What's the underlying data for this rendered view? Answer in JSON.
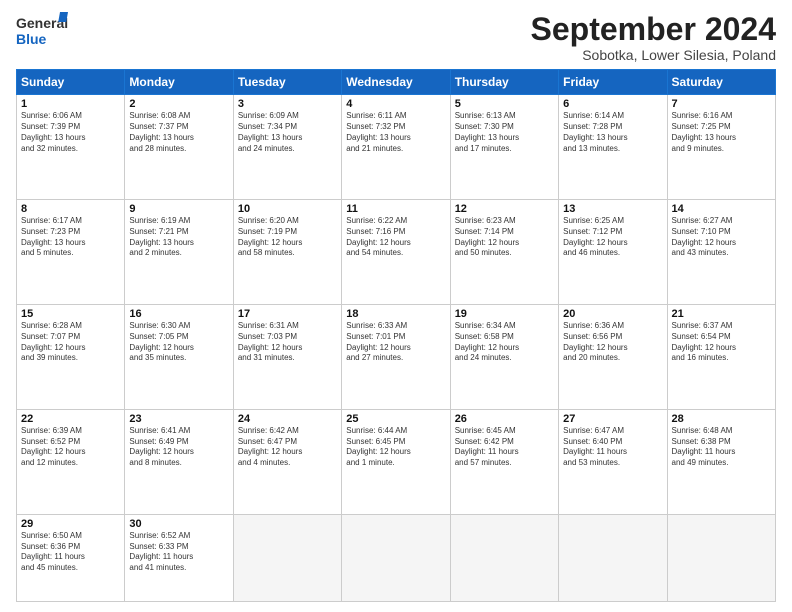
{
  "header": {
    "logo_line1": "General",
    "logo_line2": "Blue",
    "month": "September 2024",
    "location": "Sobotka, Lower Silesia, Poland"
  },
  "weekdays": [
    "Sunday",
    "Monday",
    "Tuesday",
    "Wednesday",
    "Thursday",
    "Friday",
    "Saturday"
  ],
  "weeks": [
    [
      {
        "day": "1",
        "text": "Sunrise: 6:06 AM\nSunset: 7:39 PM\nDaylight: 13 hours\nand 32 minutes."
      },
      {
        "day": "2",
        "text": "Sunrise: 6:08 AM\nSunset: 7:37 PM\nDaylight: 13 hours\nand 28 minutes."
      },
      {
        "day": "3",
        "text": "Sunrise: 6:09 AM\nSunset: 7:34 PM\nDaylight: 13 hours\nand 24 minutes."
      },
      {
        "day": "4",
        "text": "Sunrise: 6:11 AM\nSunset: 7:32 PM\nDaylight: 13 hours\nand 21 minutes."
      },
      {
        "day": "5",
        "text": "Sunrise: 6:13 AM\nSunset: 7:30 PM\nDaylight: 13 hours\nand 17 minutes."
      },
      {
        "day": "6",
        "text": "Sunrise: 6:14 AM\nSunset: 7:28 PM\nDaylight: 13 hours\nand 13 minutes."
      },
      {
        "day": "7",
        "text": "Sunrise: 6:16 AM\nSunset: 7:25 PM\nDaylight: 13 hours\nand 9 minutes."
      }
    ],
    [
      {
        "day": "8",
        "text": "Sunrise: 6:17 AM\nSunset: 7:23 PM\nDaylight: 13 hours\nand 5 minutes."
      },
      {
        "day": "9",
        "text": "Sunrise: 6:19 AM\nSunset: 7:21 PM\nDaylight: 13 hours\nand 2 minutes."
      },
      {
        "day": "10",
        "text": "Sunrise: 6:20 AM\nSunset: 7:19 PM\nDaylight: 12 hours\nand 58 minutes."
      },
      {
        "day": "11",
        "text": "Sunrise: 6:22 AM\nSunset: 7:16 PM\nDaylight: 12 hours\nand 54 minutes."
      },
      {
        "day": "12",
        "text": "Sunrise: 6:23 AM\nSunset: 7:14 PM\nDaylight: 12 hours\nand 50 minutes."
      },
      {
        "day": "13",
        "text": "Sunrise: 6:25 AM\nSunset: 7:12 PM\nDaylight: 12 hours\nand 46 minutes."
      },
      {
        "day": "14",
        "text": "Sunrise: 6:27 AM\nSunset: 7:10 PM\nDaylight: 12 hours\nand 43 minutes."
      }
    ],
    [
      {
        "day": "15",
        "text": "Sunrise: 6:28 AM\nSunset: 7:07 PM\nDaylight: 12 hours\nand 39 minutes."
      },
      {
        "day": "16",
        "text": "Sunrise: 6:30 AM\nSunset: 7:05 PM\nDaylight: 12 hours\nand 35 minutes."
      },
      {
        "day": "17",
        "text": "Sunrise: 6:31 AM\nSunset: 7:03 PM\nDaylight: 12 hours\nand 31 minutes."
      },
      {
        "day": "18",
        "text": "Sunrise: 6:33 AM\nSunset: 7:01 PM\nDaylight: 12 hours\nand 27 minutes."
      },
      {
        "day": "19",
        "text": "Sunrise: 6:34 AM\nSunset: 6:58 PM\nDaylight: 12 hours\nand 24 minutes."
      },
      {
        "day": "20",
        "text": "Sunrise: 6:36 AM\nSunset: 6:56 PM\nDaylight: 12 hours\nand 20 minutes."
      },
      {
        "day": "21",
        "text": "Sunrise: 6:37 AM\nSunset: 6:54 PM\nDaylight: 12 hours\nand 16 minutes."
      }
    ],
    [
      {
        "day": "22",
        "text": "Sunrise: 6:39 AM\nSunset: 6:52 PM\nDaylight: 12 hours\nand 12 minutes."
      },
      {
        "day": "23",
        "text": "Sunrise: 6:41 AM\nSunset: 6:49 PM\nDaylight: 12 hours\nand 8 minutes."
      },
      {
        "day": "24",
        "text": "Sunrise: 6:42 AM\nSunset: 6:47 PM\nDaylight: 12 hours\nand 4 minutes."
      },
      {
        "day": "25",
        "text": "Sunrise: 6:44 AM\nSunset: 6:45 PM\nDaylight: 12 hours\nand 1 minute."
      },
      {
        "day": "26",
        "text": "Sunrise: 6:45 AM\nSunset: 6:42 PM\nDaylight: 11 hours\nand 57 minutes."
      },
      {
        "day": "27",
        "text": "Sunrise: 6:47 AM\nSunset: 6:40 PM\nDaylight: 11 hours\nand 53 minutes."
      },
      {
        "day": "28",
        "text": "Sunrise: 6:48 AM\nSunset: 6:38 PM\nDaylight: 11 hours\nand 49 minutes."
      }
    ],
    [
      {
        "day": "29",
        "text": "Sunrise: 6:50 AM\nSunset: 6:36 PM\nDaylight: 11 hours\nand 45 minutes."
      },
      {
        "day": "30",
        "text": "Sunrise: 6:52 AM\nSunset: 6:33 PM\nDaylight: 11 hours\nand 41 minutes."
      },
      {
        "day": "",
        "text": ""
      },
      {
        "day": "",
        "text": ""
      },
      {
        "day": "",
        "text": ""
      },
      {
        "day": "",
        "text": ""
      },
      {
        "day": "",
        "text": ""
      }
    ]
  ]
}
